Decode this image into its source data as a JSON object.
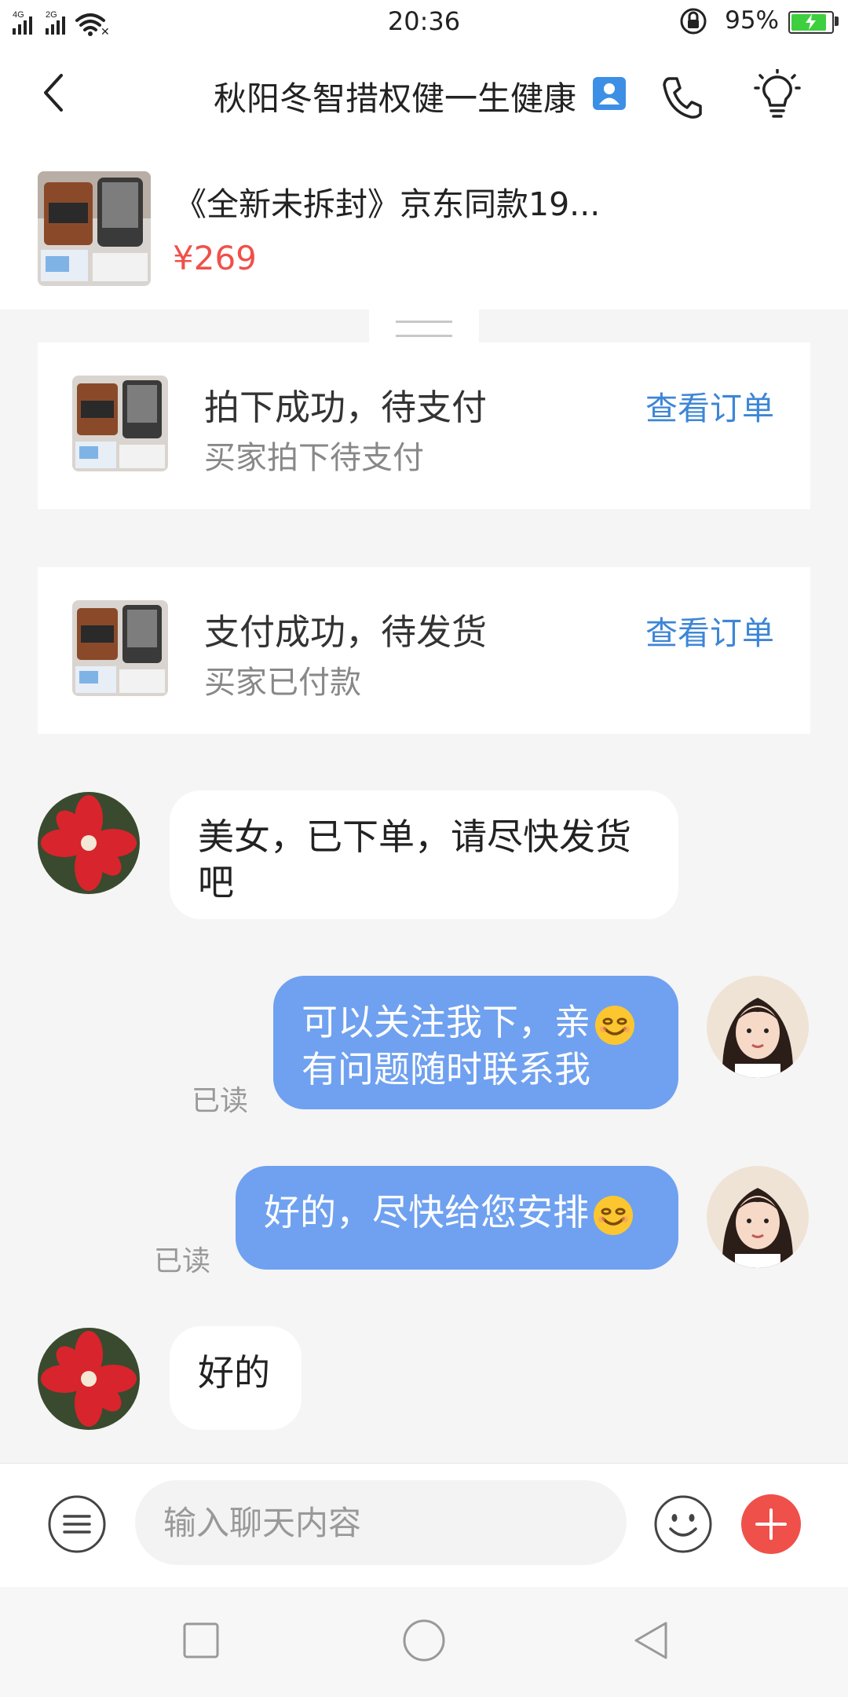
{
  "status_bar": {
    "network_1": "4G",
    "network_2": "2G",
    "time": "20:36",
    "battery_percent": "95%",
    "battery_level": 0.95,
    "icons": [
      "signal-icon",
      "wifi-icon",
      "rotation-lock-icon",
      "battery-icon"
    ]
  },
  "header": {
    "title": "秋阳冬智措权健一生健康",
    "icons": [
      "back-arrow-icon",
      "contact-card-icon",
      "phone-icon",
      "lightbulb-icon"
    ]
  },
  "product": {
    "title": "《全新未拆封》京东同款19...",
    "price": "¥269"
  },
  "orders": [
    {
      "title": "拍下成功，待支付",
      "subtitle": "买家拍下待支付",
      "link": "查看订单"
    },
    {
      "title": "支付成功，待发货",
      "subtitle": "买家已付款",
      "link": "查看订单"
    }
  ],
  "messages": [
    {
      "side": "in",
      "lines": [
        "美女，已下单，请尽快发货",
        "吧"
      ]
    },
    {
      "side": "out",
      "lines": [
        "可以关注我下，亲",
        "有问题随时联系我"
      ],
      "emoji": "smile",
      "status": "已读"
    },
    {
      "side": "out",
      "lines": [
        "好的，尽快给您安排"
      ],
      "emoji": "smile",
      "status": "已读"
    },
    {
      "side": "in",
      "lines": [
        "好的"
      ]
    }
  ],
  "input_bar": {
    "placeholder": "输入聊天内容",
    "icons": [
      "menu-icon",
      "emoji-icon",
      "plus-icon"
    ]
  },
  "nav_bar": {
    "icons": [
      "recent-apps-icon",
      "home-icon",
      "back-icon"
    ]
  },
  "colors": {
    "accent_blue": "#3d86d6",
    "outgoing_bubble": "#6fa1f0",
    "price_red": "#f0504a",
    "battery_green": "#3ecf3e"
  }
}
